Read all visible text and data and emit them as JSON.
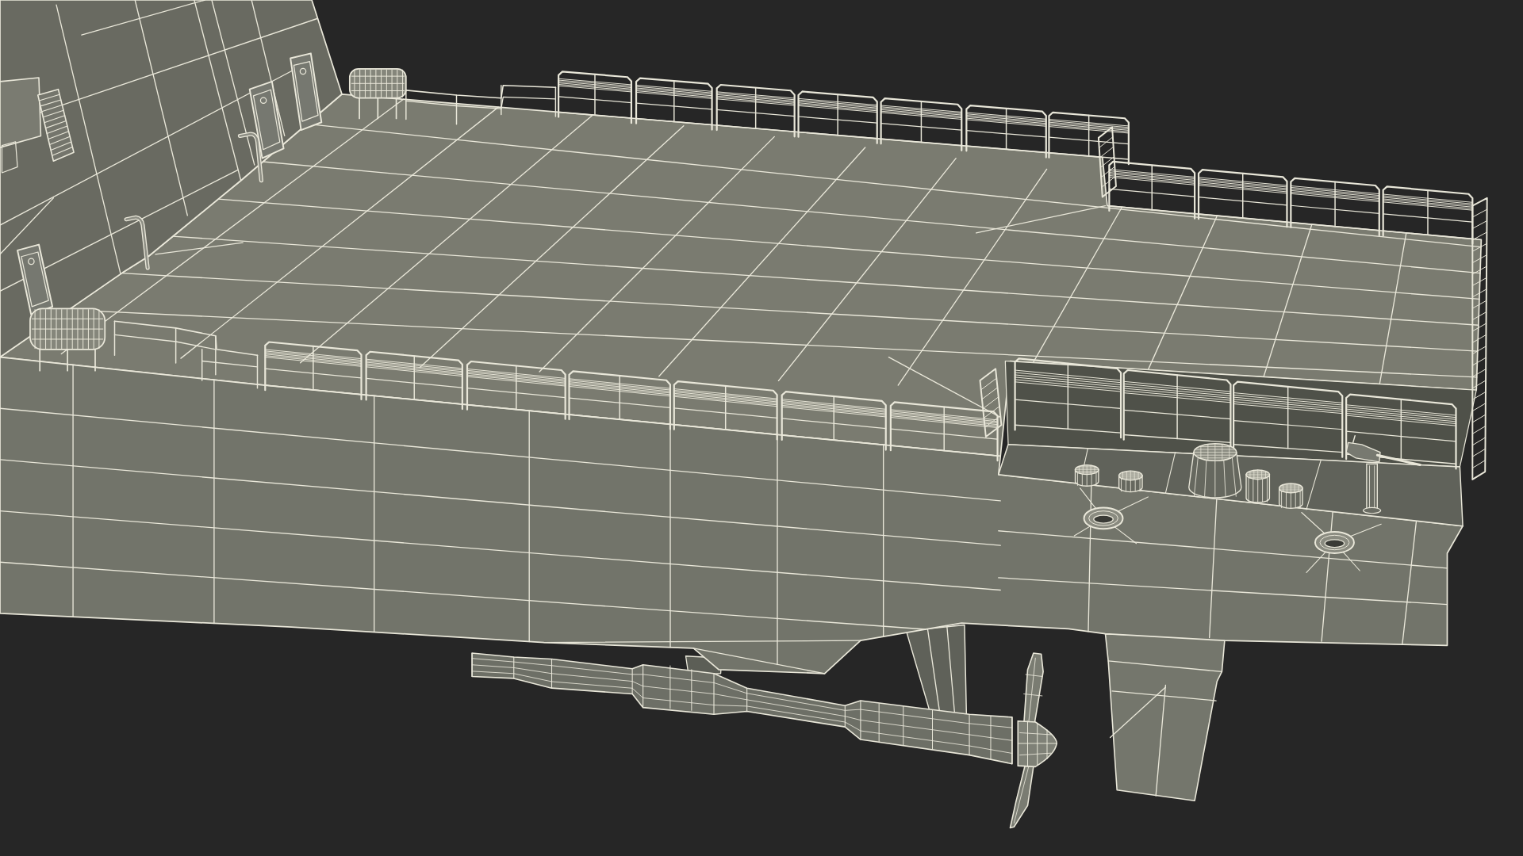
{
  "scene": {
    "parts": [
      {
        "kind": "strut"
      },
      {
        "kind": "rudder"
      },
      {
        "kind": "deck"
      },
      {
        "kind": "hull"
      },
      {
        "kind": "well-deck"
      },
      {
        "kind": "superstructure"
      },
      {
        "kind": "railings"
      },
      {
        "kind": "life-rafts"
      },
      {
        "kind": "deck-fittings"
      },
      {
        "kind": "hawse-holes"
      },
      {
        "kind": "shaft"
      },
      {
        "kind": "propeller"
      }
    ]
  }
}
